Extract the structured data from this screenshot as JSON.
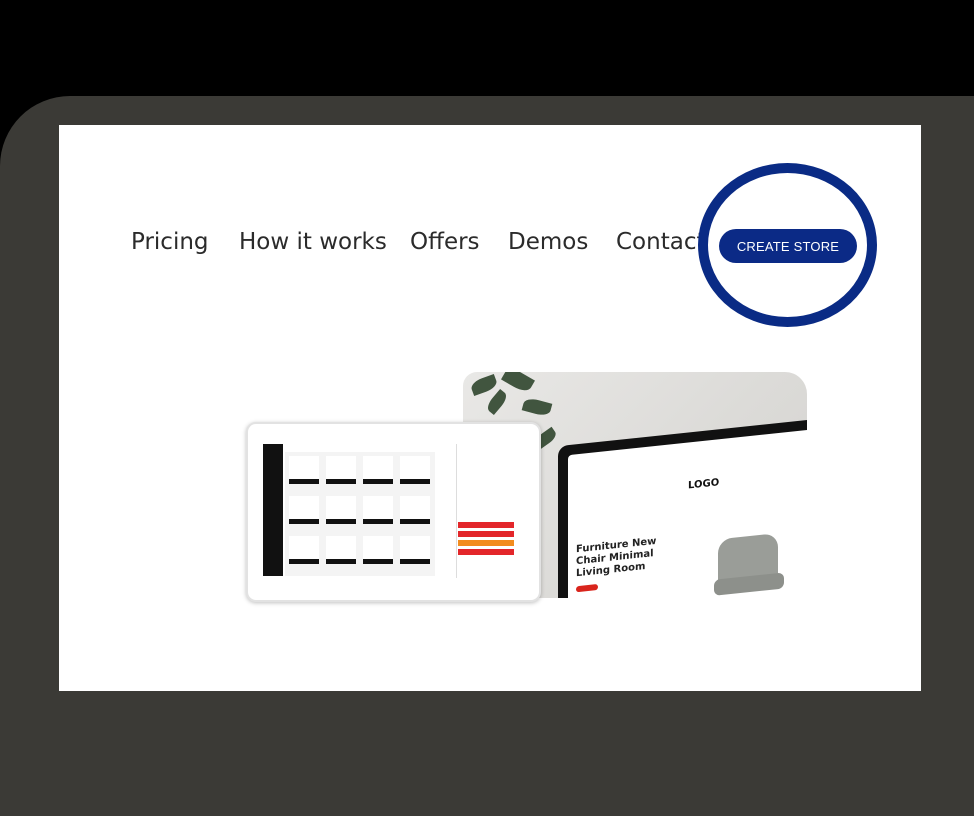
{
  "nav": {
    "links": [
      "Pricing",
      "How it works",
      "Offers",
      "Demos",
      "Contact"
    ],
    "cta": "CREATE STORE"
  },
  "hero": {
    "laptop_logo": "LOGO",
    "laptop_headline": "Furniture New Chair Minimal Living Room"
  },
  "colors": {
    "accent": "#0b2a86",
    "frame": "#3b3a36",
    "highlight_ring": "#0a2b85"
  }
}
